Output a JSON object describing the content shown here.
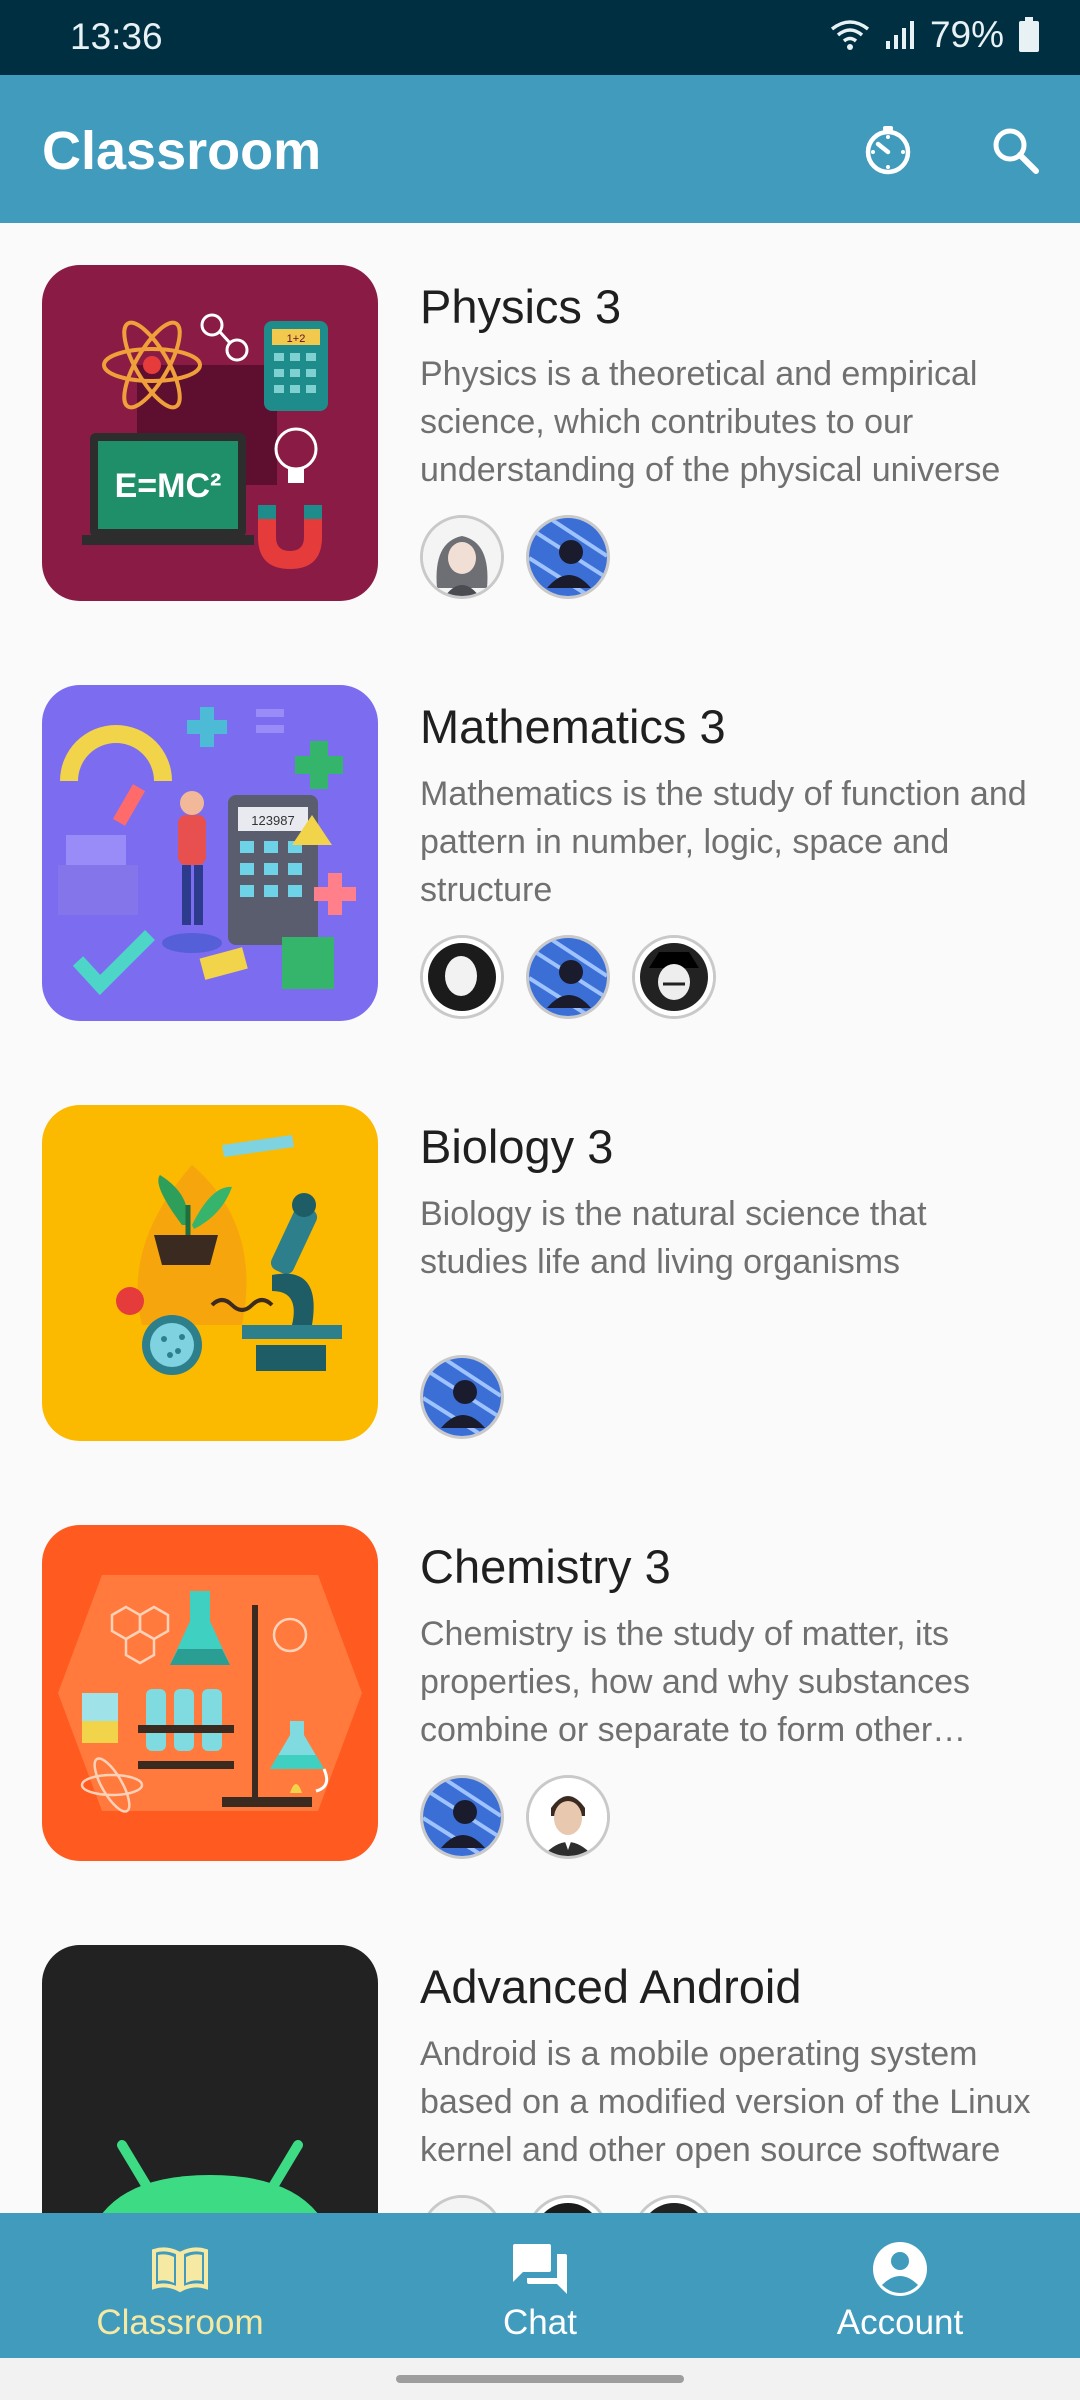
{
  "status_bar": {
    "time": "13:36",
    "battery": "79%"
  },
  "app_bar": {
    "title": "Classroom",
    "timer_icon": "timer-icon",
    "search_icon": "search-icon"
  },
  "courses": [
    {
      "title": "Physics 3",
      "description": "Physics is a theoretical and empirical science, which contributes to our understanding of the physical universe",
      "color": "#8a1b45",
      "members": [
        "anime-girl",
        "blue-manga"
      ]
    },
    {
      "title": "Mathematics 3",
      "description": "Mathematics is the study of function and pattern in number, logic, space and structure",
      "color": "#7c6cf0",
      "members": [
        "bw-bearded",
        "blue-manga",
        "bw-hat"
      ]
    },
    {
      "title": "Biology 3",
      "description": "Biology is the natural science that studies life and living organisms",
      "color": "#fbb900",
      "members": [
        "blue-manga"
      ]
    },
    {
      "title": "Chemistry 3",
      "description": "Chemistry is the study of matter, its properties, how and why substances combine or separate to form other substances",
      "color": "#ff5a1f",
      "members": [
        "blue-manga",
        "suit-man"
      ]
    },
    {
      "title": "Advanced Android",
      "description": "Android is a mobile operating system based on a modified version of the Linux kernel and other open source software",
      "color": "#222222",
      "members": [
        "light-avatar",
        "bw-bearded",
        "bw-hat"
      ]
    }
  ],
  "physics_thumb": {
    "formula": "E=MC²",
    "calc_display": "1+2"
  },
  "math_thumb": {
    "calc_display": "123987"
  },
  "bottom_nav": {
    "classroom": "Classroom",
    "chat": "Chat",
    "account": "Account"
  },
  "colors": {
    "status_bar": "#002f42",
    "app_bar": "#409bbd",
    "active_nav": "#f6e9a4",
    "android_green": "#3ddc84"
  }
}
